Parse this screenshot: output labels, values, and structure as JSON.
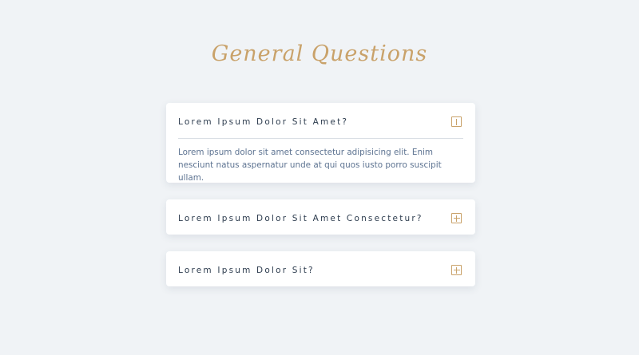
{
  "page": {
    "title": "General Questions"
  },
  "faq": [
    {
      "question": "Lorem Ipsum Dolor Sit Amet?",
      "answer": "Lorem ipsum dolor sit amet consectetur adipisicing elit. Enim nesciunt natus aspernatur unde at qui quos iusto porro suscipit ullam.",
      "expanded": true,
      "icon": "minus-square-icon"
    },
    {
      "question": "Lorem Ipsum Dolor Sit Amet Consectetur?",
      "expanded": false,
      "icon": "plus-square-icon"
    },
    {
      "question": "Lorem Ipsum Dolor Sit?",
      "expanded": false,
      "icon": "plus-square-icon"
    }
  ],
  "colors": {
    "accent": "#c9a26a",
    "background": "#f0f3f6",
    "question_text": "#2e3d4f",
    "answer_text": "#5d7391"
  }
}
